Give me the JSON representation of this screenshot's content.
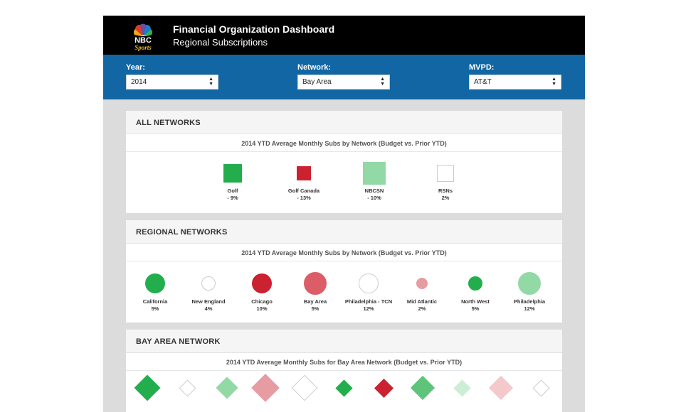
{
  "header": {
    "title": "Financial Organization Dashboard",
    "subtitle": "Regional Subscriptions",
    "logo_text": "NBC Sports"
  },
  "filters": [
    {
      "label": "Year:",
      "value": "2014"
    },
    {
      "label": "Network:",
      "value": "Bay Area"
    },
    {
      "label": "MVPD:",
      "value": "AT&T"
    }
  ],
  "colors": {
    "dark_green": "#23ae4d",
    "light_green": "#93d9a6",
    "pale_green": "#cdeed6",
    "dark_red": "#cb2130",
    "mid_red": "#dc5c67",
    "light_red": "#e69ca2",
    "pale_red": "#f3c9cc",
    "neutral": "#ffffff",
    "header_bg": "#000000",
    "filter_bg": "#1266a4"
  },
  "all_networks": {
    "heading": "ALL NETWORKS",
    "chart_title": "2014 YTD Average Monthly Subs by Network (Budget vs. Prior YTD)",
    "items": [
      {
        "name": "Golf",
        "value": "- 9%",
        "color": "#23ae4d"
      },
      {
        "name": "Golf Canada",
        "value": "- 13%",
        "color": "#cb2130"
      },
      {
        "name": "NBCSN",
        "value": "- 10%",
        "color": "#93d9a6"
      },
      {
        "name": "RSNs",
        "value": "2%",
        "color": "#ffffff"
      }
    ]
  },
  "regional_networks": {
    "heading": "REGIONAL NETWORKS",
    "chart_title": "2014 YTD Average Monthly Subs by Network (Budget vs. Prior YTD)",
    "items": [
      {
        "name": "California",
        "value": "5%",
        "color": "#23ae4d"
      },
      {
        "name": "New England",
        "value": "4%",
        "color": "#ffffff"
      },
      {
        "name": "Chicago",
        "value": "10%",
        "color": "#cb2130"
      },
      {
        "name": "Bay Area",
        "value": "5%",
        "color": "#dc5c67"
      },
      {
        "name": "Philadelphia - TCN",
        "value": "12%",
        "color": "#ffffff"
      },
      {
        "name": "Mid Atlantic",
        "value": "2%",
        "color": "#e69ca2"
      },
      {
        "name": "North West",
        "value": "5%",
        "color": "#23ae4d"
      },
      {
        "name": "Philadelphia",
        "value": "12%",
        "color": "#93d9a6"
      }
    ]
  },
  "bay_area_network": {
    "heading": "BAY AREA NETWORK",
    "chart_title": "2014 YTD Average Monthly Subs for Bay Area Network (Budget vs. Prior YTD)",
    "items": [
      {
        "color": "#23ae4d"
      },
      {
        "color": "#ffffff"
      },
      {
        "color": "#93d9a6"
      },
      {
        "color": "#e69ca2"
      },
      {
        "color": "#ffffff"
      },
      {
        "color": "#23ae4d"
      },
      {
        "color": "#cb2130"
      },
      {
        "color": "#5dc47a"
      },
      {
        "color": "#cdeed6"
      },
      {
        "color": "#f3c9cc"
      },
      {
        "color": "#ffffff"
      }
    ]
  }
}
